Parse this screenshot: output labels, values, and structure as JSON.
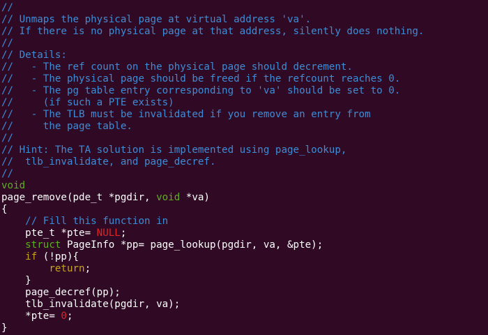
{
  "colors": {
    "background": "#300a24",
    "text": "#ffffff",
    "comment": "#3d8cd6",
    "type": "#5fae1f",
    "keyword": "#c9a416",
    "constant": "#e02424"
  },
  "lines": [
    [
      {
        "t": "comment",
        "s": "//"
      }
    ],
    [
      {
        "t": "comment",
        "s": "// Unmaps the physical page at virtual address 'va'."
      }
    ],
    [
      {
        "t": "comment",
        "s": "// If there is no physical page at that address, silently does nothing."
      }
    ],
    [
      {
        "t": "comment",
        "s": "//"
      }
    ],
    [
      {
        "t": "comment",
        "s": "// Details:"
      }
    ],
    [
      {
        "t": "comment",
        "s": "//   - The ref count on the physical page should decrement."
      }
    ],
    [
      {
        "t": "comment",
        "s": "//   - The physical page should be freed if the refcount reaches 0."
      }
    ],
    [
      {
        "t": "comment",
        "s": "//   - The pg table entry corresponding to 'va' should be set to 0."
      }
    ],
    [
      {
        "t": "comment",
        "s": "//     (if such a PTE exists)"
      }
    ],
    [
      {
        "t": "comment",
        "s": "//   - The TLB must be invalidated if you remove an entry from"
      }
    ],
    [
      {
        "t": "comment",
        "s": "//     the page table."
      }
    ],
    [
      {
        "t": "comment",
        "s": "//"
      }
    ],
    [
      {
        "t": "comment",
        "s": "// Hint: The TA solution is implemented using page_lookup,"
      }
    ],
    [
      {
        "t": "comment",
        "s": "//  tlb_invalidate, and page_decref."
      }
    ],
    [
      {
        "t": "comment",
        "s": "//"
      }
    ],
    [
      {
        "t": "type",
        "s": "void"
      }
    ],
    [
      {
        "t": "plain",
        "s": "page_remove(pde_t *pgdir, "
      },
      {
        "t": "type",
        "s": "void"
      },
      {
        "t": "plain",
        "s": " *va)"
      }
    ],
    [
      {
        "t": "plain",
        "s": "{"
      }
    ],
    [
      {
        "t": "plain",
        "s": "    "
      },
      {
        "t": "comment",
        "s": "// Fill this function in"
      }
    ],
    [
      {
        "t": "plain",
        "s": "    pte_t *pte= "
      },
      {
        "t": "constant",
        "s": "NULL"
      },
      {
        "t": "plain",
        "s": ";"
      }
    ],
    [
      {
        "t": "plain",
        "s": "    "
      },
      {
        "t": "type",
        "s": "struct"
      },
      {
        "t": "plain",
        "s": " PageInfo *pp= page_lookup(pgdir, va, &pte);"
      }
    ],
    [
      {
        "t": "plain",
        "s": "    "
      },
      {
        "t": "keyword",
        "s": "if"
      },
      {
        "t": "plain",
        "s": " (!pp){"
      }
    ],
    [
      {
        "t": "plain",
        "s": "        "
      },
      {
        "t": "keyword",
        "s": "return"
      },
      {
        "t": "plain",
        "s": ";"
      }
    ],
    [
      {
        "t": "plain",
        "s": "    }"
      }
    ],
    [
      {
        "t": "plain",
        "s": "    page_decref(pp);"
      }
    ],
    [
      {
        "t": "plain",
        "s": "    tlb_invalidate(pgdir, va);"
      }
    ],
    [
      {
        "t": "plain",
        "s": "    *pte= "
      },
      {
        "t": "constant",
        "s": "0"
      },
      {
        "t": "plain",
        "s": ";"
      }
    ],
    [
      {
        "t": "plain",
        "s": "}"
      }
    ]
  ]
}
